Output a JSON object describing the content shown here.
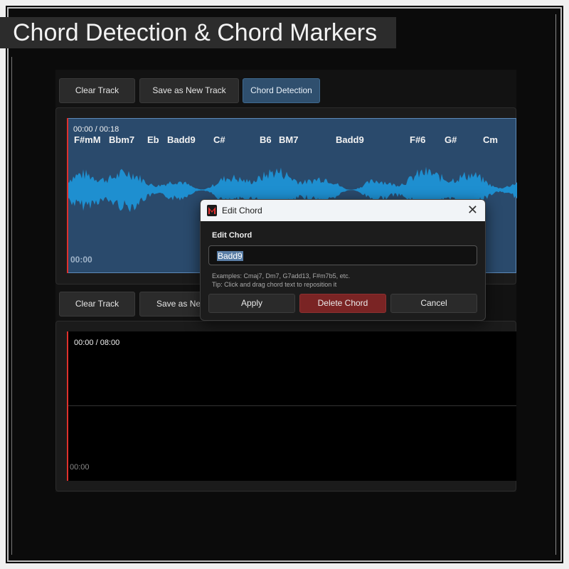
{
  "headline": "Chord Detection & Chord Markers",
  "track1": {
    "toolbar": {
      "clear": "Clear Track",
      "save": "Save as New Track",
      "detect": "Chord Detection"
    },
    "time": "00:00 / 00:18",
    "start": "00:00",
    "chords": [
      "F#mM",
      "Bbm7",
      "Eb",
      "Badd9",
      "C#",
      "B6",
      "BM7",
      "Badd9",
      "F#6",
      "G#",
      "Cm"
    ]
  },
  "track2": {
    "toolbar": {
      "clear": "Clear Track",
      "save": "Save as New"
    },
    "time": "00:00 / 08:00",
    "start": "00:00"
  },
  "dialog": {
    "title": "Edit Chord",
    "close_glyph": "✕",
    "heading": "Edit Chord",
    "value": "Badd9",
    "examples": "Examples: Cmaj7, Dm7, G7add13, F#m7b5, etc.",
    "tip": "Tip: Click and drag chord text to reposition it",
    "apply": "Apply",
    "delete": "Delete Chord",
    "cancel": "Cancel",
    "app_icon": "app-logo-icon"
  },
  "colors": {
    "waveform": "#1e8fd0",
    "wave_bg": "#2a4a6c",
    "cursor": "#e0302c",
    "active_button": "#2f4f6e",
    "danger_button": "#7a2424"
  }
}
